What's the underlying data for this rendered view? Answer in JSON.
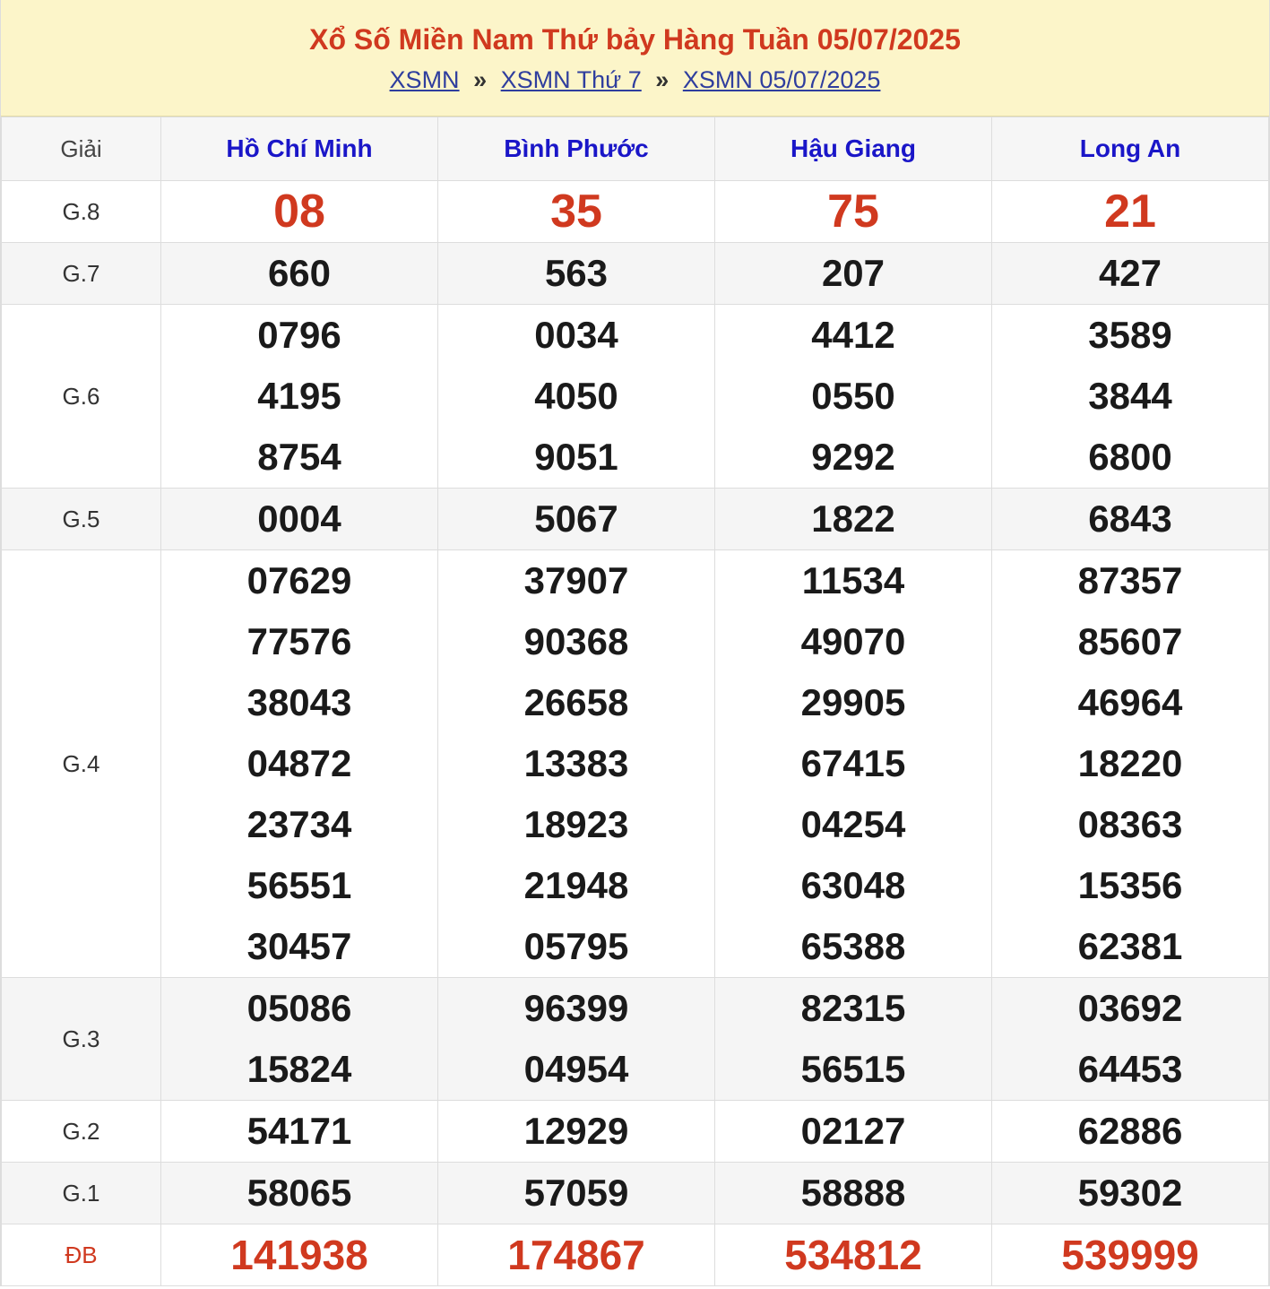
{
  "header": {
    "title": "Xổ Số Miền Nam Thứ bảy Hàng Tuần 05/07/2025",
    "breadcrumb": [
      {
        "label": "XSMN"
      },
      {
        "label": "XSMN Thứ 7"
      },
      {
        "label": "XSMN 05/07/2025"
      }
    ],
    "separator": "»"
  },
  "table": {
    "prize_header": "Giải",
    "provinces": [
      "Hồ Chí Minh",
      "Bình Phước",
      "Hậu Giang",
      "Long An"
    ],
    "rows": [
      {
        "label": "G.8",
        "values": [
          [
            "08"
          ],
          [
            "35"
          ],
          [
            "75"
          ],
          [
            "21"
          ]
        ]
      },
      {
        "label": "G.7",
        "values": [
          [
            "660"
          ],
          [
            "563"
          ],
          [
            "207"
          ],
          [
            "427"
          ]
        ]
      },
      {
        "label": "G.6",
        "values": [
          [
            "0796",
            "4195",
            "8754"
          ],
          [
            "0034",
            "4050",
            "9051"
          ],
          [
            "4412",
            "0550",
            "9292"
          ],
          [
            "3589",
            "3844",
            "6800"
          ]
        ]
      },
      {
        "label": "G.5",
        "values": [
          [
            "0004"
          ],
          [
            "5067"
          ],
          [
            "1822"
          ],
          [
            "6843"
          ]
        ]
      },
      {
        "label": "G.4",
        "values": [
          [
            "07629",
            "77576",
            "38043",
            "04872",
            "23734",
            "56551",
            "30457"
          ],
          [
            "37907",
            "90368",
            "26658",
            "13383",
            "18923",
            "21948",
            "05795"
          ],
          [
            "11534",
            "49070",
            "29905",
            "67415",
            "04254",
            "63048",
            "65388"
          ],
          [
            "87357",
            "85607",
            "46964",
            "18220",
            "08363",
            "15356",
            "62381"
          ]
        ]
      },
      {
        "label": "G.3",
        "values": [
          [
            "05086",
            "15824"
          ],
          [
            "96399",
            "04954"
          ],
          [
            "82315",
            "56515"
          ],
          [
            "03692",
            "64453"
          ]
        ]
      },
      {
        "label": "G.2",
        "values": [
          [
            "54171"
          ],
          [
            "12929"
          ],
          [
            "02127"
          ],
          [
            "62886"
          ]
        ]
      },
      {
        "label": "G.1",
        "values": [
          [
            "58065"
          ],
          [
            "57059"
          ],
          [
            "58888"
          ],
          [
            "59302"
          ]
        ]
      },
      {
        "label": "ĐB",
        "values": [
          [
            "141938"
          ],
          [
            "174867"
          ],
          [
            "534812"
          ],
          [
            "539999"
          ]
        ]
      }
    ]
  },
  "colors": {
    "title": "#d0391f",
    "header_bg": "#fcf5c9",
    "province": "#1a16c8",
    "special": "#d0391f",
    "link": "#2f3e9e"
  }
}
